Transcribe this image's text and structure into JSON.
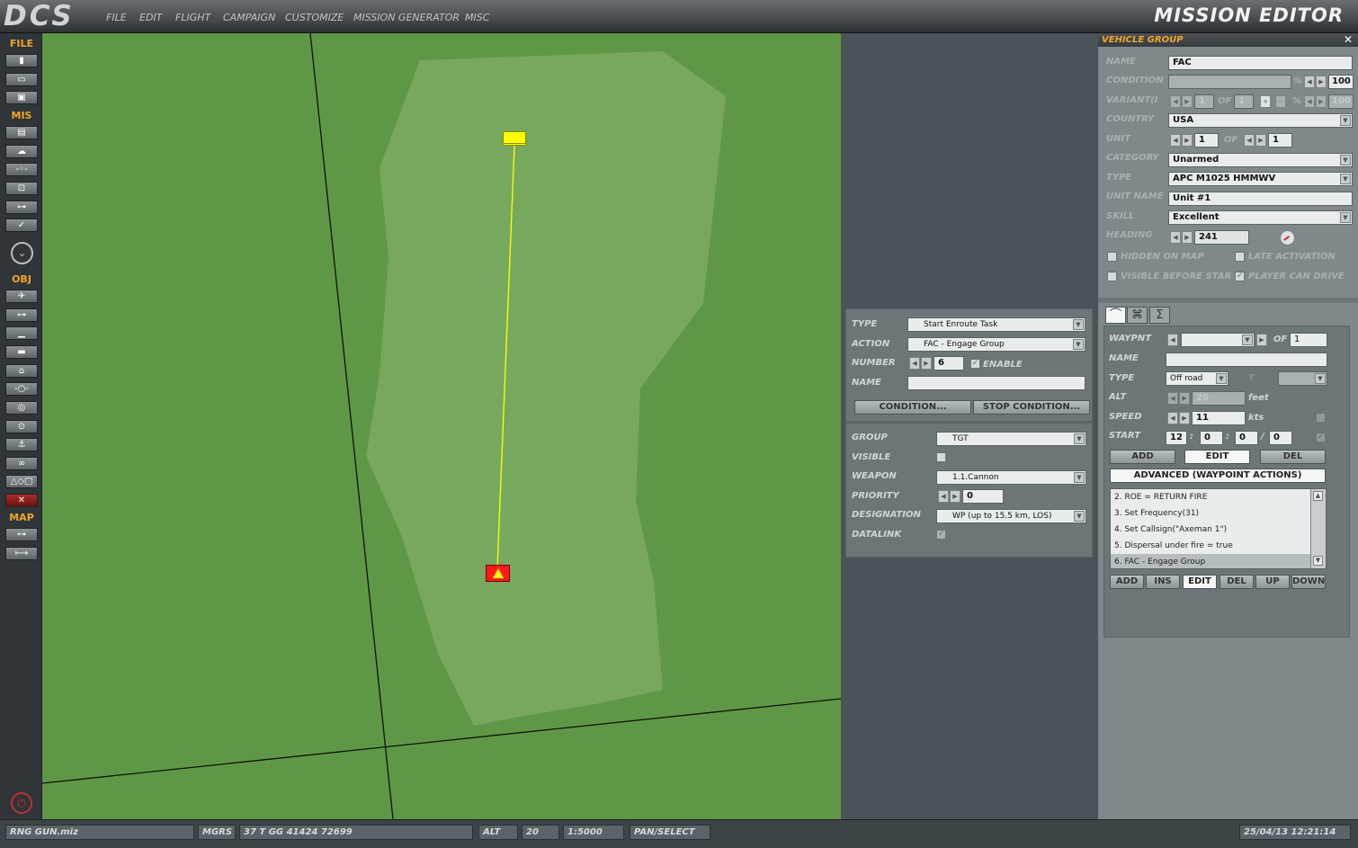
{
  "topbar": {
    "logo": "DCS",
    "menu": [
      "FILE",
      "EDIT",
      "FLIGHT",
      "CAMPAIGN",
      "CUSTOMIZE",
      "MISSION GENERATOR",
      "MISC"
    ],
    "title": "MISSION EDITOR"
  },
  "left_toolbar": {
    "sections": {
      "file": "FILE",
      "mis": "MIS",
      "obj": "OBJ",
      "map": "MAP"
    }
  },
  "vehicle_group": {
    "title": "VEHICLE GROUP",
    "close": "✕",
    "labels": {
      "name": "NAME",
      "condition": "CONDITION",
      "variant": "VARIANT(I",
      "country": "COUNTRY",
      "unit": "UNIT",
      "category": "CATEGORY",
      "type": "TYPE",
      "unit_name": "UNIT NAME",
      "skill": "SKILL",
      "heading": "HEADING",
      "of": "OF",
      "percent": "%"
    },
    "name": "FAC",
    "condition_value": "100",
    "variant_value": "1",
    "variant_of": "1",
    "variant_pct": "100",
    "country": "USA",
    "unit_index": "1",
    "unit_count": "1",
    "category": "Unarmed",
    "type": "APC M1025 HMMWV",
    "unit_name": "Unit #1",
    "skill": "Excellent",
    "heading": "241",
    "checkboxes": {
      "hidden_on_map": "HIDDEN ON MAP",
      "late_activation": "LATE ACTIVATION",
      "visible_before_start": "VISIBLE BEFORE STAR",
      "player_can_drive": "PLAYER CAN DRIVE"
    }
  },
  "waypoint": {
    "labels": {
      "waypnt": "WAYPNT",
      "of": "OF",
      "name": "NAME",
      "type": "TYPE",
      "alt": "ALT",
      "speed": "SPEED",
      "start": "START",
      "t": "T"
    },
    "of_value": "1",
    "name_value": "",
    "type_value": "Off road",
    "alt_value": "20",
    "alt_unit": "feet",
    "speed_value": "11",
    "speed_unit": "kts",
    "start": {
      "h": "12",
      "m": "0",
      "s": "0",
      "d": "0"
    },
    "buttons": {
      "add": "ADD",
      "edit": "EDIT",
      "del": "DEL"
    },
    "advanced": "ADVANCED (WAYPOINT ACTIONS)",
    "actions": [
      "2. ROE = RETURN FIRE",
      "3. Set Frequency(31)",
      "4. Set Callsign(\"Axeman 1\")",
      "5. Dispersal under fire = true",
      "6. FAC - Engage Group"
    ],
    "list_buttons": {
      "add": "ADD",
      "ins": "INS",
      "edit": "EDIT",
      "del": "DEL",
      "up": "UP",
      "down": "DOWN"
    }
  },
  "task": {
    "labels": {
      "type": "TYPE",
      "action": "ACTION",
      "number": "NUMBER",
      "enable": "ENABLE",
      "name": "NAME",
      "group": "GROUP",
      "visible": "VISIBLE",
      "weapon": "WEAPON",
      "priority": "PRIORITY",
      "designation": "DESIGNATION",
      "datalink": "DATALINK"
    },
    "type": "Start Enroute Task",
    "action": "FAC - Engage Group",
    "number": "6",
    "name": "",
    "condition_btn": "CONDITION...",
    "stop_condition_btn": "STOP CONDITION...",
    "group": "TGT",
    "weapon": "1.1.Cannon",
    "priority": "0",
    "designation": "WP (up to 15.5 km, LOS)"
  },
  "statusbar": {
    "file": "RNG GUN.miz",
    "coord_type": "MGRS",
    "coords": "37 T GG 41424 72699",
    "alt_label": "ALT",
    "alt_value": "20",
    "scale": "1:5000",
    "mode": "PAN/SELECT",
    "datetime": "25/04/13 12:21:14"
  },
  "colors": {
    "accent": "#f2a526",
    "map_green": "#5e9847",
    "map_light": "#78a85e",
    "unit_yellow": "#ffff00",
    "unit_red": "#ff1a1a"
  }
}
